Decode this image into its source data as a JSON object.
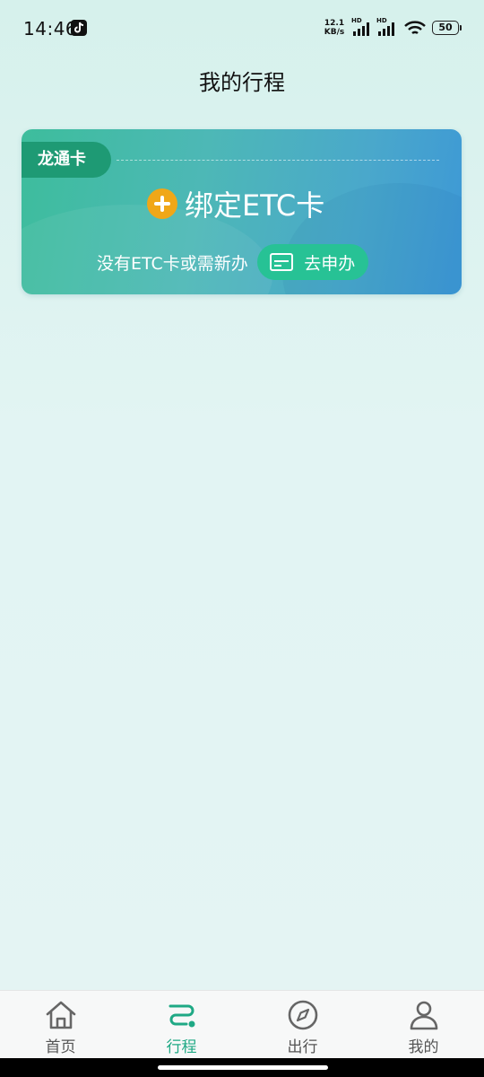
{
  "status_bar": {
    "time": "14:46",
    "net_speed_value": "12.1",
    "net_speed_unit": "KB/s",
    "sim1_label": "HD",
    "sim2_label": "HD",
    "battery": "50"
  },
  "header": {
    "title": "我的行程"
  },
  "card": {
    "tag": "龙通卡",
    "bind_label": "绑定ETC卡",
    "no_card_text": "没有ETC卡或需新办",
    "apply_label": "去申办"
  },
  "bottom_nav": {
    "items": [
      {
        "label": "首页",
        "icon": "home-icon",
        "active": false
      },
      {
        "label": "行程",
        "icon": "route-icon",
        "active": true
      },
      {
        "label": "出行",
        "icon": "compass-icon",
        "active": false
      },
      {
        "label": "我的",
        "icon": "person-icon",
        "active": false
      }
    ]
  },
  "colors": {
    "accent": "#1fa985",
    "card_tag": "#1e9a74",
    "plus_icon": "#f0a718",
    "apply_button": "#27c295"
  }
}
